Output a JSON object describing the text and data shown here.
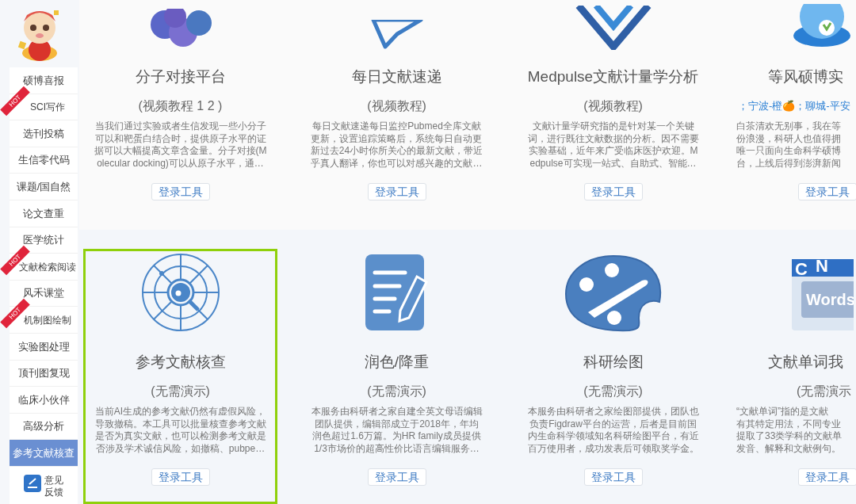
{
  "sidebar": {
    "items": [
      {
        "label": "硕博喜报",
        "selected": false
      },
      {
        "label": "SCI写作",
        "selected": false,
        "badge": "HOT"
      },
      {
        "label": "选刊投稿",
        "selected": false
      },
      {
        "label": "生信零代码",
        "selected": false
      },
      {
        "label": "课题/国自然",
        "selected": false
      },
      {
        "label": "论文查重",
        "selected": false
      },
      {
        "label": "医学统计",
        "selected": false
      },
      {
        "label": "文献检索阅读",
        "selected": false,
        "badge": "HOT"
      },
      {
        "label": "风禾课堂",
        "selected": false
      },
      {
        "label": "机制图绘制",
        "selected": false,
        "badge": "HOT"
      },
      {
        "label": "实验图处理",
        "selected": false
      },
      {
        "label": "顶刊图复现",
        "selected": false
      },
      {
        "label": "临床小伙伴",
        "selected": false
      },
      {
        "label": "高级分析",
        "selected": false
      },
      {
        "label": "参考文献核查",
        "selected": true
      }
    ],
    "feedback": {
      "lines": [
        "意见",
        "反馈"
      ]
    }
  },
  "rows": [
    {
      "cards": [
        {
          "title": "分子对接平台",
          "subtitle": "(视频教程 1 2 )",
          "highlighted": false,
          "description": [
            "当我们通过实验或者生信发现一些小分子",
            "可以和靶蛋白结合时，提供原子水平的证",
            "据可以大幅提高文章含金量。分子对接(M",
            "olecular docking)可以从原子水平，通…"
          ],
          "button": "登录工具"
        },
        {
          "title": "每日文献速递",
          "subtitle": "(视频教程)",
          "highlighted": false,
          "description": [
            "每日文献速递每日监控Pubmed全库文献",
            "更新，设置追踪策略后，系统每日自动更",
            "新过去24小时你所关心的最新文献，带近",
            "乎真人翻译，你也可以对感兴趣的文献…"
          ],
          "button": "登录工具"
        },
        {
          "title": "Medpulse文献计量学分析",
          "subtitle": "(视频教程)",
          "highlighted": false,
          "description": [
            "文献计量学研究指的是针对某一个关键",
            "词，进行既往文献数据的分析。因不需要",
            "实验基础，近年来广受临床医护欢迎。M",
            "edpulse可实现一站式、自助式、智能…"
          ],
          "button": "登录工具"
        },
        {
          "title": "等风硕博实",
          "subtitle": "；宁波-橙🍊；聊城-平安",
          "highlighted": false,
          "description": [
            "白茶清欢无别事，我在等",
            "份浪漫，科研人也值得拥",
            "唯一只面向生命科学硕博",
            "台，上线后得到澎湃新闻"
          ],
          "button": "登录工具"
        }
      ]
    },
    {
      "cards": [
        {
          "title": "参考文献核查",
          "subtitle": "(无需演示)",
          "highlighted": true,
          "description": [
            "当前AI生成的参考文献仍然有虚假风险，",
            "导致撤稿。本工具可以批量核查参考文献",
            "是否为真实文献，也可以检测参考文献是",
            "否涉及学术诚信风险，如撤稿、pubpe…"
          ],
          "button": "登录工具"
        },
        {
          "title": "润色/降重",
          "subtitle": "(无需演示)",
          "highlighted": false,
          "description": [
            "本服务由科研者之家自建全英文母语编辑",
            "团队提供，编辑部成立于2018年，年均",
            "润色超过1.6万篇。为HR family成员提供",
            "1/3市场价的超高性价比语言编辑服务…"
          ],
          "button": "登录工具"
        },
        {
          "title": "科研绘图",
          "subtitle": "(无需演示)",
          "highlighted": false,
          "description": [
            "本服务由科研者之家绘图部提供，团队也",
            "负责Figdraw平台的运营，后者是目前国",
            "内生命科学领域知名科研绘图平台，有近",
            "百万使用者，成功发表后可领取奖学金。"
          ],
          "button": "登录工具"
        },
        {
          "icon_text": [
            "C",
            "N",
            "Words"
          ],
          "title": "文献单词我",
          "subtitle": "(无需演示",
          "highlighted": false,
          "description": [
            "“文献单词”指的是文献",
            "有其特定用法，不同专业",
            "提取了33类学科的文献单",
            "发音、解释和文献例句。"
          ],
          "button": "登录工具"
        }
      ]
    }
  ]
}
